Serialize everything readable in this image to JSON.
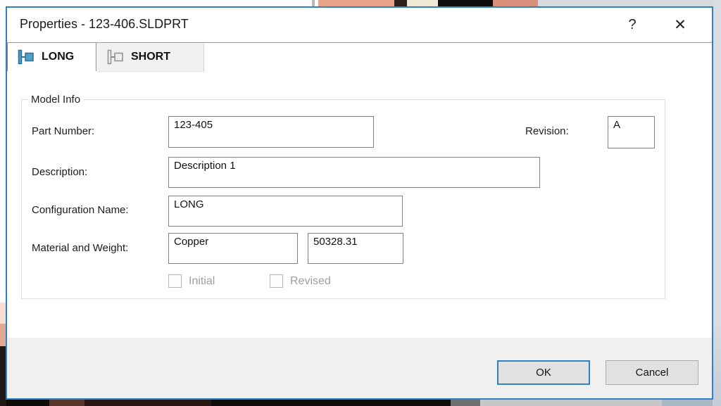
{
  "dialog": {
    "title": "Properties - 123-406.SLDPRT",
    "help_label": "?",
    "close_label": "✕",
    "tabs": [
      {
        "label": "LONG",
        "active": true,
        "icon": "config-flag-icon"
      },
      {
        "label": "SHORT",
        "active": false,
        "icon": "config-flag-icon"
      }
    ],
    "group": {
      "legend": "Model Info",
      "part_number": {
        "label": "Part Number:",
        "value": "123-405"
      },
      "revision": {
        "label": "Revision:",
        "value": "A"
      },
      "description": {
        "label": "Description:",
        "value": "Description 1"
      },
      "configuration": {
        "label": "Configuration Name:",
        "value": "LONG"
      },
      "material_weight": {
        "label": "Material and Weight:",
        "material": "Copper",
        "weight": "50328.31"
      },
      "checkboxes": [
        {
          "label": "Initial",
          "checked": false
        },
        {
          "label": "Revised",
          "checked": false
        }
      ]
    },
    "buttons": {
      "ok": "OK",
      "cancel": "Cancel"
    }
  },
  "colors": {
    "dialog_border": "#2e81c4",
    "ok_button_border": "#2e81c4",
    "footer_bg": "#f0f0f0",
    "active_tab_icon_fill": "#4f9fc6",
    "active_tab_icon_stroke": "#2e6f94",
    "inactive_tab_icon_fill": "#ededed",
    "inactive_tab_icon_stroke": "#8f8f8f",
    "disabled_text": "#9e9e9e"
  }
}
